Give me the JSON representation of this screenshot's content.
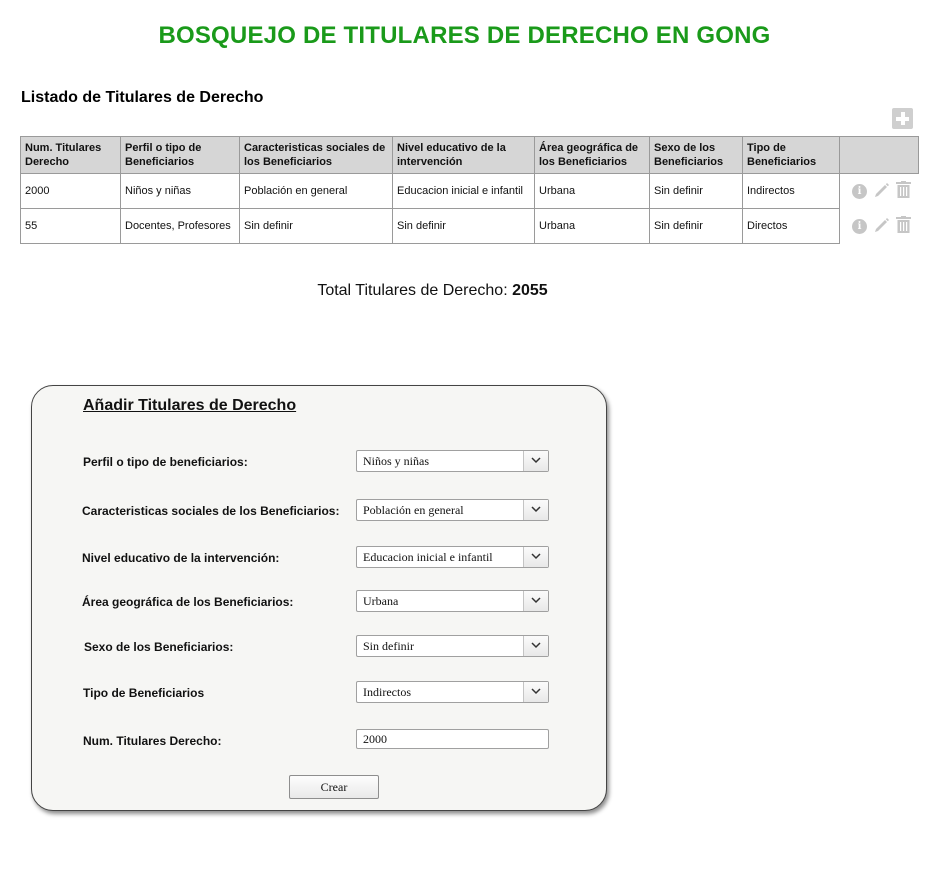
{
  "page": {
    "title": "BOSQUEJO DE TITULARES DE DERECHO EN GONG"
  },
  "list": {
    "title": "Listado de Titulares de Derecho",
    "add_icon": "plus-icon",
    "headers": [
      "Num. Titulares Derecho",
      "Perfil o tipo de Beneficiarios",
      "Caracteristicas sociales de los Beneficiarios",
      "Nivel educativo de la intervención",
      "Área geográfica de los Beneficiarios",
      "Sexo de los Beneficiarios",
      "Tipo de Beneficiarios"
    ],
    "rows": [
      [
        "2000",
        "Niños y niñas",
        "Población en general",
        "Educacion inicial e infantil",
        "Urbana",
        "Sin definir",
        "Indirectos"
      ],
      [
        "55",
        "Docentes, Profesores",
        "Sin definir",
        "Sin definir",
        "Urbana",
        "Sin definir",
        "Directos"
      ]
    ],
    "row_action_icons": [
      "info-icon",
      "pencil-icon",
      "trash-icon"
    ]
  },
  "total": {
    "label": "Total Titulares de Derecho:",
    "value": "2055"
  },
  "form": {
    "title": "Añadir Titulares de Derecho",
    "perfil": {
      "label": "Perfil o tipo de beneficiarios:",
      "value": "Niños y niñas"
    },
    "caracteristicas": {
      "label": "Caracteristicas sociales de los Beneficiarios:",
      "value": "Población en general"
    },
    "nivel": {
      "label": "Nivel educativo de la intervención:",
      "value": "Educacion inicial e infantil"
    },
    "area": {
      "label": "Área geográfica de los Beneficiarios:",
      "value": "Urbana"
    },
    "sexo": {
      "label": "Sexo de los Beneficiarios:",
      "value": "Sin definir"
    },
    "tipo": {
      "label": "Tipo de Beneficiarios",
      "value": "Indirectos"
    },
    "num": {
      "label": "Num. Titulares Derecho:",
      "value": "2000"
    },
    "submit_label": "Crear"
  },
  "colors": {
    "title_green": "#1a9a1a",
    "header_gray": "#d6d6d6",
    "icon_gray": "#c6c6c6"
  }
}
